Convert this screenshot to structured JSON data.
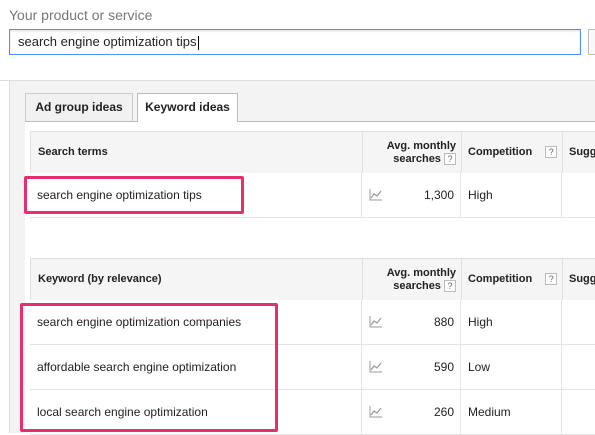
{
  "product": {
    "label": "Your product or service",
    "value": "search engine optimization tips"
  },
  "tabs": [
    {
      "label": "Ad group ideas",
      "active": false
    },
    {
      "label": "Keyword ideas",
      "active": true
    }
  ],
  "search_terms_table": {
    "headers": {
      "term": "Search terms",
      "avg_line1": "Avg. monthly",
      "avg_line2": "searches",
      "competition": "Competition",
      "suggested": "Sugg"
    },
    "rows": [
      {
        "term": "search engine optimization tips",
        "searches": "1,300",
        "competition": "High"
      }
    ]
  },
  "keyword_table": {
    "headers": {
      "term": "Keyword (by relevance)",
      "avg_line1": "Avg. monthly",
      "avg_line2": "searches",
      "competition": "Competition",
      "suggested": "Sugg"
    },
    "rows": [
      {
        "term": "search engine optimization companies",
        "searches": "880",
        "competition": "High"
      },
      {
        "term": "affordable search engine optimization",
        "searches": "590",
        "competition": "Low"
      },
      {
        "term": "local search engine optimization",
        "searches": "260",
        "competition": "Medium"
      }
    ]
  },
  "help_glyph": "?",
  "colors": {
    "highlight": "#e6306e",
    "input_focus_border": "#4d90fe"
  }
}
